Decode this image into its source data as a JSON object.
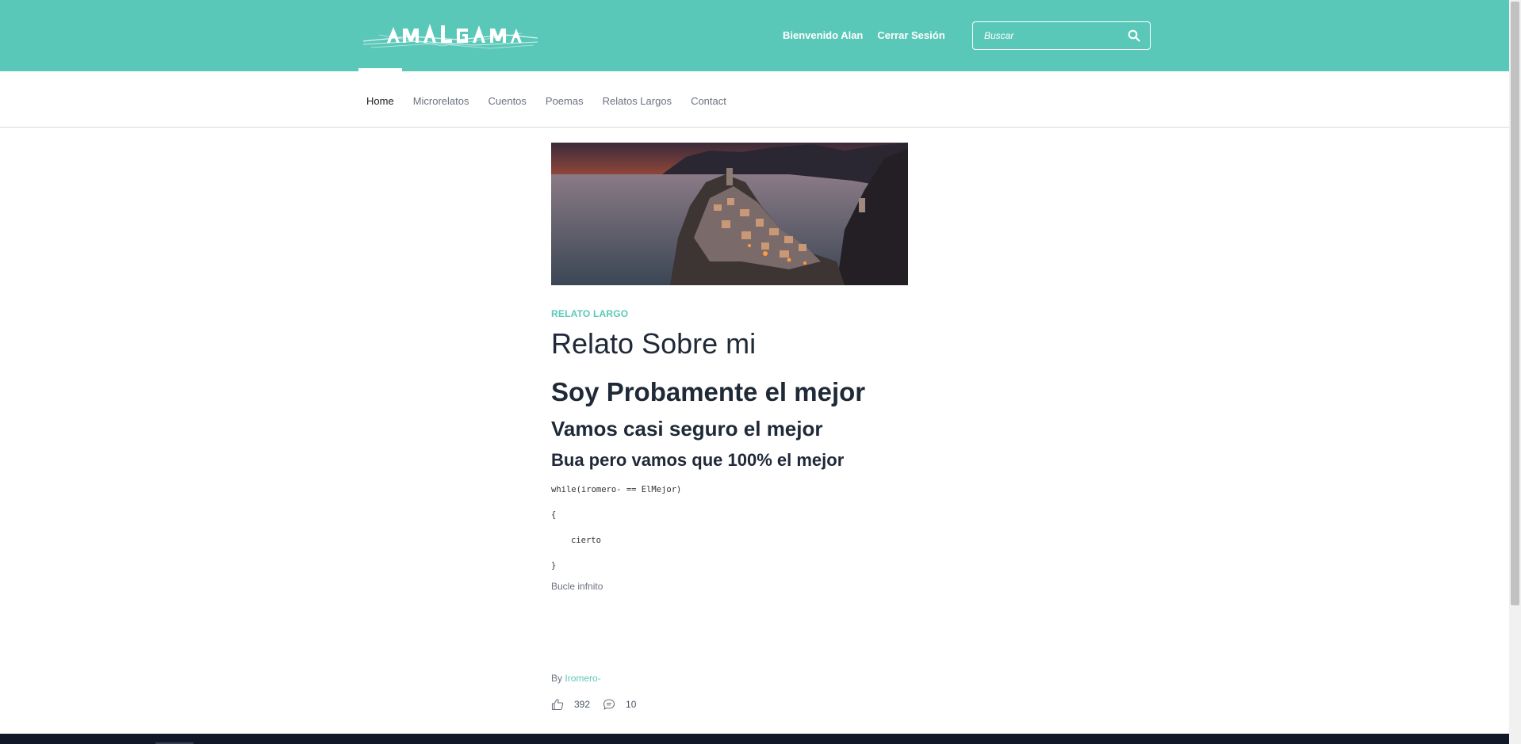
{
  "brand": {
    "logo_text": "AMALGAMA"
  },
  "header": {
    "welcome": "Bienvenido Alan",
    "logout": "Cerrar Sesión",
    "search_placeholder": "Buscar"
  },
  "nav": {
    "items": [
      {
        "label": "Home",
        "active": true
      },
      {
        "label": "Microrelatos"
      },
      {
        "label": "Cuentos"
      },
      {
        "label": "Poemas"
      },
      {
        "label": "Relatos Largos"
      },
      {
        "label": "Contact"
      }
    ]
  },
  "article": {
    "category": "RELATO LARGO",
    "title": "Relato Sobre mi",
    "heading_1": "Soy Probamente el mejor",
    "heading_2": "Vamos casi seguro el mejor",
    "heading_3": "Bua pero vamos que 100% el mejor",
    "code_lines": [
      "while(iromero- == ElMejor)",
      "{",
      "cierto",
      "}"
    ],
    "note": "Bucle infnito",
    "by_label": "By",
    "author": "Iromero-",
    "likes": "392",
    "comments": "10"
  },
  "colors": {
    "brand": "#5ac8b8",
    "text": "#1f2937",
    "muted": "#6b7280"
  },
  "icons": {
    "search": "search-icon",
    "like": "thumbs-up-icon",
    "comment": "comment-icon"
  }
}
